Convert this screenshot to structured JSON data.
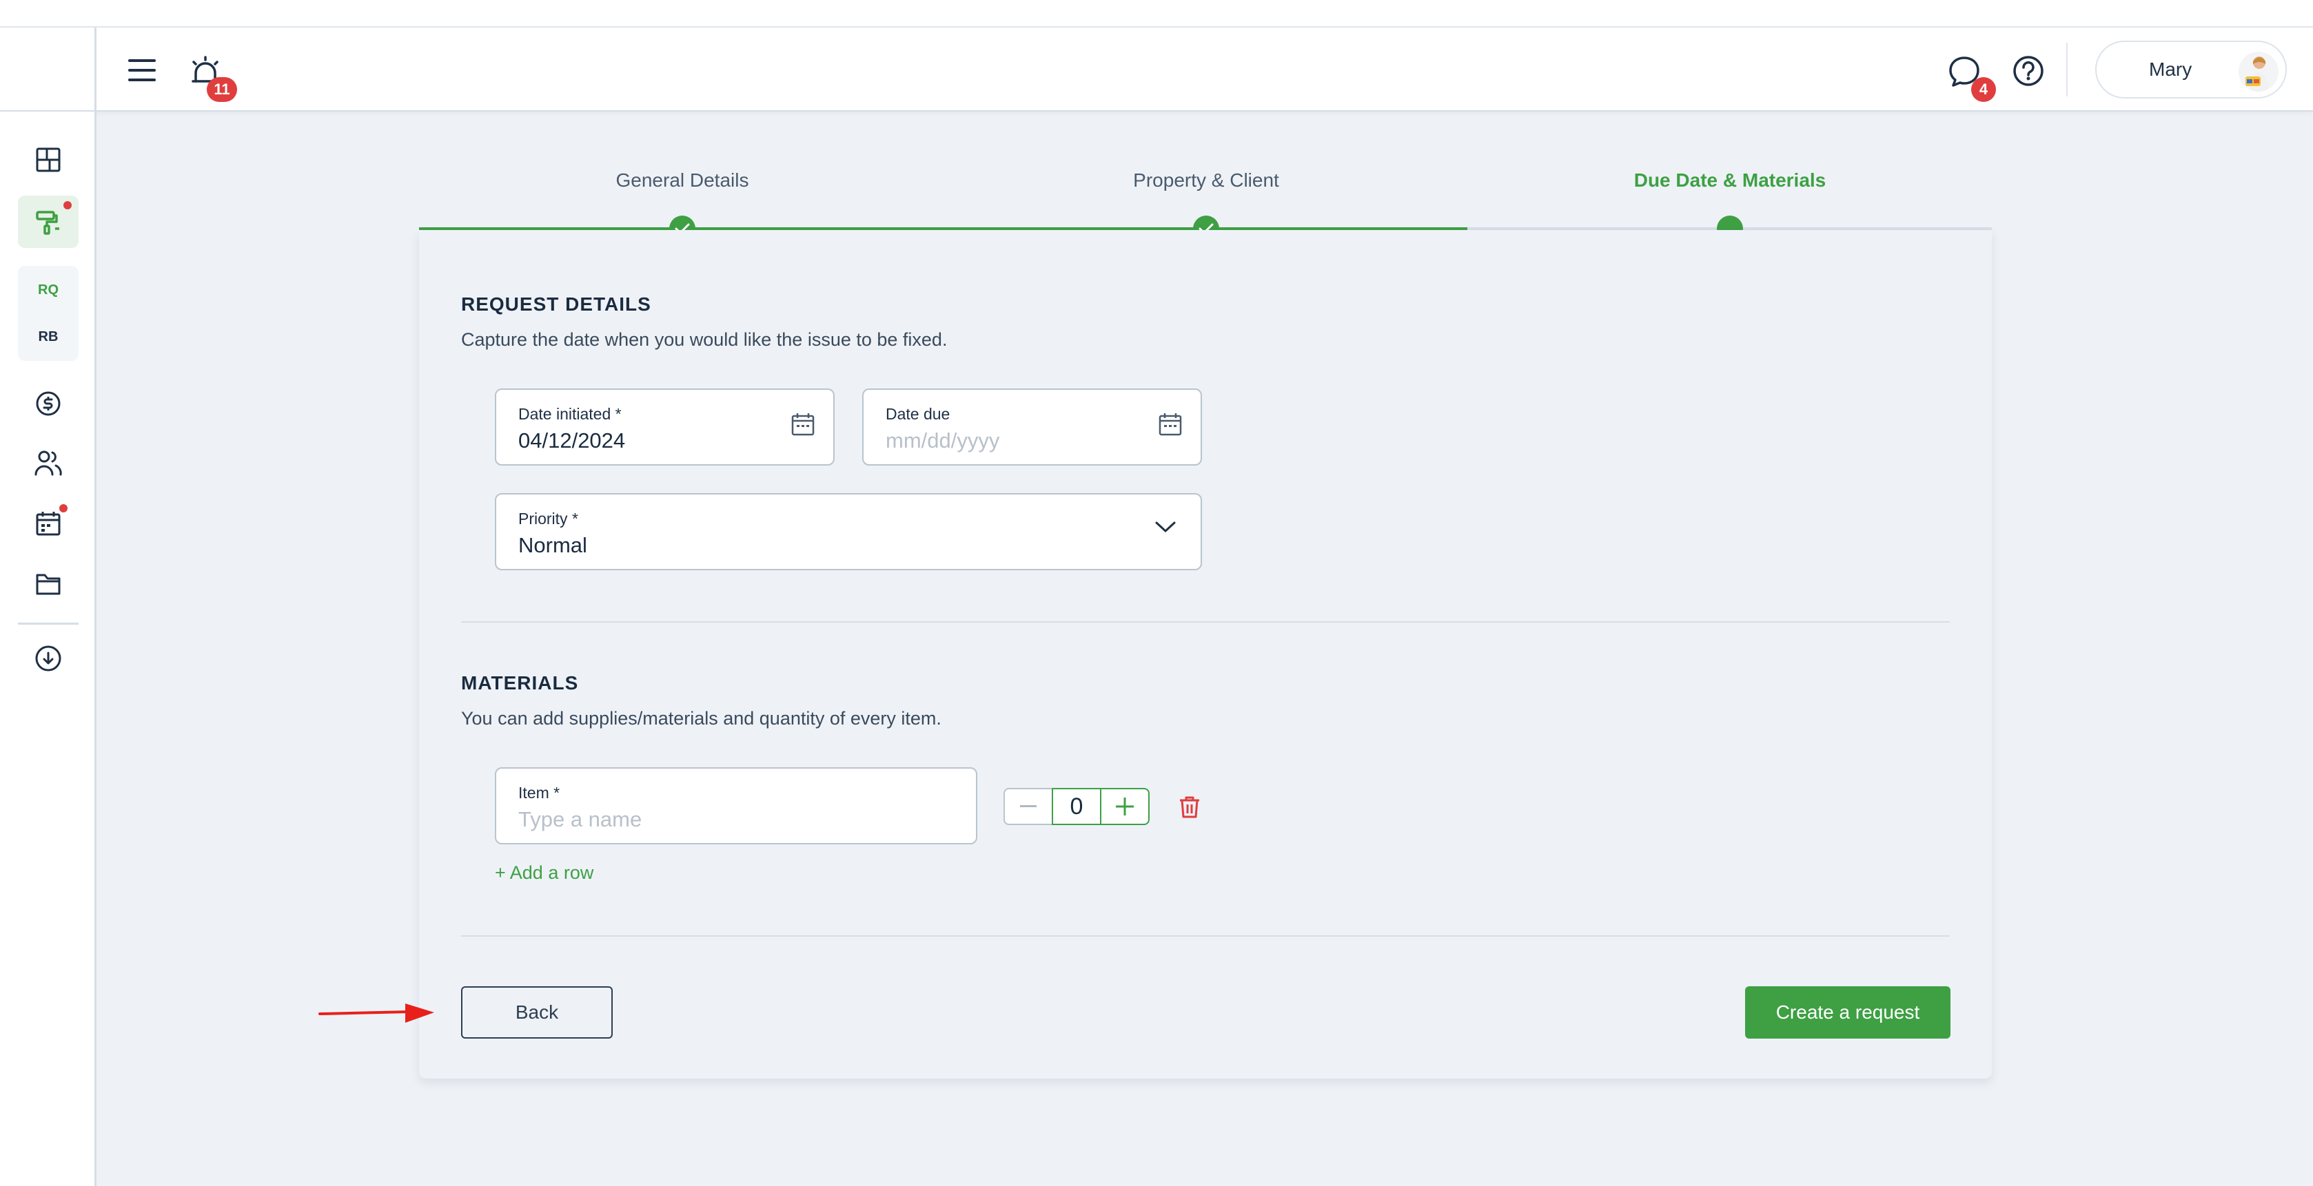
{
  "header": {
    "menu_icon": "hamburger-menu-icon",
    "alerts_icon": "alarm-bell-icon",
    "alerts_count": "11",
    "messages_icon": "chat-bubble-icon",
    "messages_count": "4",
    "help_icon": "help-circle-icon",
    "user_name": "Mary"
  },
  "sidebar": {
    "items": [
      {
        "icon": "dashboard-grid-icon"
      },
      {
        "icon": "paint-roller-icon",
        "active": true
      },
      {
        "label": "RQ"
      },
      {
        "label": "RB"
      },
      {
        "icon": "dollar-circle-icon"
      },
      {
        "icon": "users-icon"
      },
      {
        "icon": "calendar-icon"
      },
      {
        "icon": "folder-icon"
      },
      {
        "icon": "cloud-download-icon"
      }
    ]
  },
  "stepper": {
    "steps": [
      {
        "label": "General Details",
        "status": "done"
      },
      {
        "label": "Property & Client",
        "status": "done"
      },
      {
        "label": "Due Date & Materials",
        "status": "current"
      }
    ]
  },
  "request_details": {
    "title": "REQUEST DETAILS",
    "subtitle": "Capture the date when you would like the issue to be fixed.",
    "date_initiated_label": "Date initiated *",
    "date_initiated_value": "04/12/2024",
    "date_due_label": "Date due",
    "date_due_placeholder": "mm/dd/yyyy",
    "priority_label": "Priority *",
    "priority_value": "Normal"
  },
  "materials": {
    "title": "MATERIALS",
    "subtitle": "You can add supplies/materials and quantity of every item.",
    "item_label": "Item *",
    "item_placeholder": "Type a name",
    "quantity": "0",
    "add_row_label": "+ Add a row"
  },
  "actions": {
    "back_label": "Back",
    "create_label": "Create a request"
  },
  "colors": {
    "accent": "#3ea043",
    "badge": "#e03e3e",
    "text": "#1f2f44"
  }
}
